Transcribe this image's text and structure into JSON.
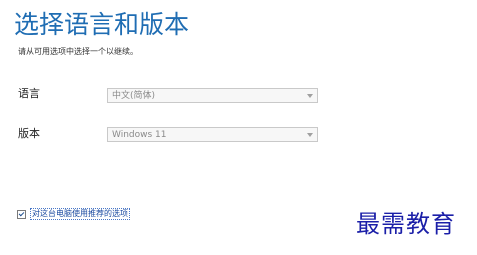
{
  "header": {
    "title": "选择语言和版本",
    "subtitle": "请从可用选项中选择一个以继续。"
  },
  "form": {
    "language": {
      "label": "语言",
      "value": "中文(简体)"
    },
    "edition": {
      "label": "版本",
      "value": "Windows 11"
    },
    "recommended_option": {
      "checked": true,
      "label": "对这台电脑使用推荐的选项"
    }
  },
  "watermark": {
    "text": "最需教育"
  },
  "colors": {
    "title": "#1f6db3",
    "watermark": "#1b1fa8",
    "checkbox_label": "#1a4aa0"
  }
}
